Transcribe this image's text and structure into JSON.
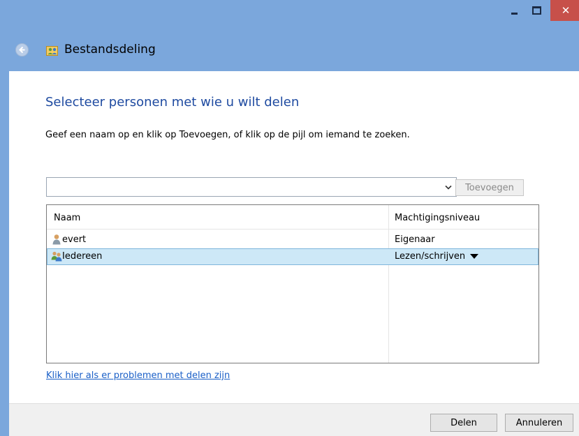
{
  "window": {
    "close_glyph": "✕"
  },
  "nav": {
    "title": "Bestandsdeling"
  },
  "main": {
    "heading": "Selecteer personen met wie u wilt delen",
    "instruction": "Geef een naam op en klik op Toevoegen, of klik op de pijl om iemand te zoeken.",
    "name_input": {
      "value": "",
      "placeholder": ""
    },
    "add_button_label": "Toevoegen",
    "table": {
      "columns": [
        "Naam",
        "Machtigingsniveau"
      ],
      "rows": [
        {
          "name": "evert",
          "permission": "Eigenaar",
          "icon": "user-icon"
        },
        {
          "name": "Iedereen",
          "permission": "Lezen/schrijven",
          "icon": "group-icon",
          "selected": true
        }
      ]
    },
    "help_link": "Klik hier als er problemen met delen zijn"
  },
  "footer": {
    "share_label": "Delen",
    "cancel_label": "Annuleren"
  },
  "colors": {
    "frame": "#7ba7dc",
    "heading": "#1e4aa0",
    "link": "#1a5fc7",
    "selection": "#cde8f7",
    "close": "#c7504a"
  }
}
